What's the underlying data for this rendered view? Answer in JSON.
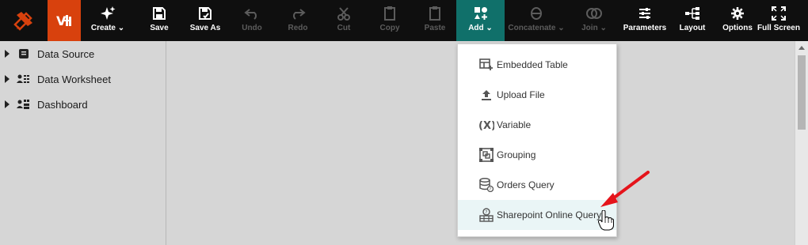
{
  "toolbar": {
    "create": "Create",
    "save": "Save",
    "save_as": "Save As",
    "undo": "Undo",
    "redo": "Redo",
    "cut": "Cut",
    "copy": "Copy",
    "paste": "Paste",
    "add": "Add",
    "concatenate": "Concatenate",
    "join": "Join",
    "parameters": "Parameters",
    "layout": "Layout",
    "options": "Options",
    "full_screen": "Full Screen"
  },
  "sidebar": {
    "items": [
      {
        "label": "Data Source",
        "icon": "database-icon"
      },
      {
        "label": "Data Worksheet",
        "icon": "worksheet-icon"
      },
      {
        "label": "Dashboard",
        "icon": "dashboard-icon"
      }
    ]
  },
  "add_menu": {
    "items": [
      {
        "label": "Embedded Table",
        "icon": "embedded-table-icon"
      },
      {
        "label": "Upload File",
        "icon": "upload-icon"
      },
      {
        "label": "Variable",
        "icon": "variable-icon"
      },
      {
        "label": "Grouping",
        "icon": "grouping-icon"
      },
      {
        "label": "Orders Query",
        "icon": "query-database-icon"
      },
      {
        "label": "Sharepoint Online Query",
        "icon": "sharepoint-icon"
      }
    ],
    "highlighted_index": 5
  },
  "colors": {
    "toolbar_bg": "#0f0f0f",
    "brand_orange": "#d8410d",
    "active_teal": "#10706a",
    "annotation_red": "#e5141b"
  }
}
